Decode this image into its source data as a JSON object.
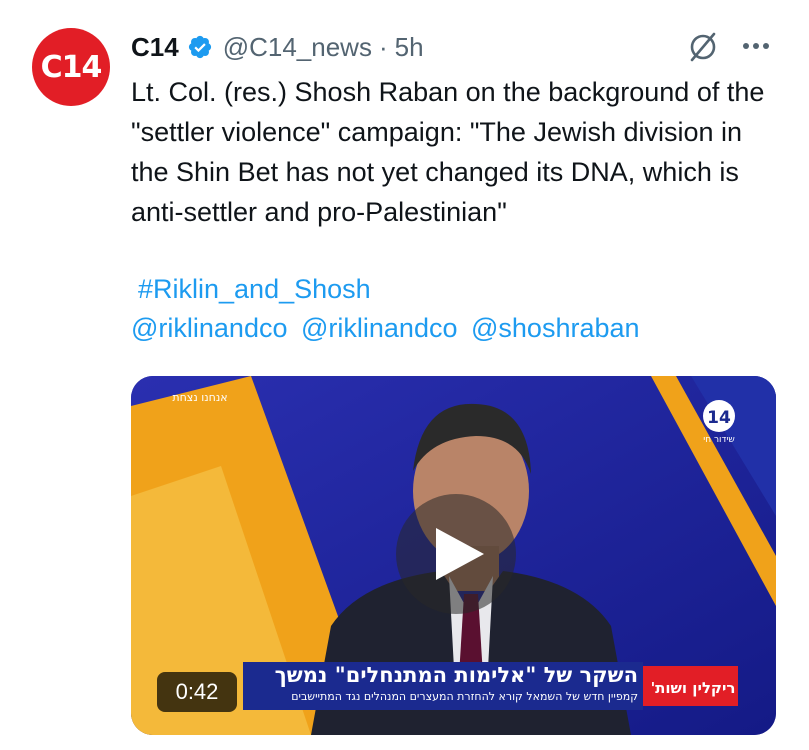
{
  "account": {
    "avatar_text": "C14",
    "name": "C14",
    "handle": "@C14_news",
    "separator": "·",
    "time": "5h"
  },
  "tweet": {
    "text": "Lt. Col. (res.) Shosh Raban on the background of the \"settler violence\" campaign: \"The Jewish division in the Shin Bet has not yet changed its DNA, which is anti-settler and pro-Palestinian\"",
    "hashtag": "#Riklin_and_Shosh",
    "mentions": [
      "@riklinandco",
      "@riklinandco",
      "@shoshraban"
    ]
  },
  "video": {
    "duration": "0:42",
    "headline": "השקר של \"אלימות המתנחלים\" נמשך",
    "subline": "קמפיין חדש של השמאל קורא להחזרת המעצרים המנהלים נגד המתיישבים",
    "show_label": "ריקלין ושות'",
    "channel": "14",
    "channel_sub": "שידור חי",
    "top_left_logo": "אנחנו נצחת"
  },
  "colors": {
    "avatar": "#e21e26",
    "link": "#1d9bf0",
    "verified": "#1d9bf0",
    "muted": "#536471"
  },
  "icons": {
    "verified": "verified-badge-icon",
    "grok": "grok-icon",
    "more": "more-icon",
    "play": "play-icon"
  }
}
